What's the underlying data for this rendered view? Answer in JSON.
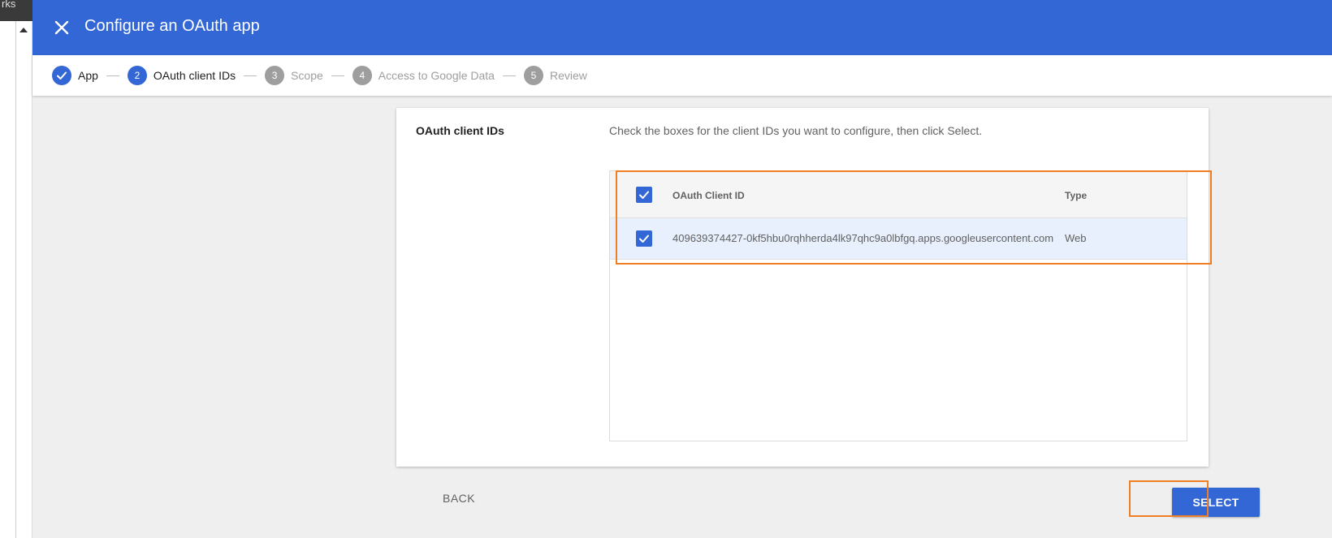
{
  "left_strip": {
    "tab_text": "rks"
  },
  "header": {
    "close_icon": "close-icon",
    "title": "Configure an OAuth app",
    "bg_color": "#3367d6"
  },
  "stepper": {
    "steps": [
      {
        "number": "",
        "label": "App",
        "state": "done",
        "icon": "check-icon"
      },
      {
        "number": "2",
        "label": "OAuth client IDs",
        "state": "active"
      },
      {
        "number": "3",
        "label": "Scope",
        "state": "pending"
      },
      {
        "number": "4",
        "label": "Access to Google Data",
        "state": "pending"
      },
      {
        "number": "5",
        "label": "Review",
        "state": "pending"
      }
    ]
  },
  "card": {
    "section_label": "OAuth client IDs",
    "instructions": "Check the boxes for the client IDs you want to configure, then click Select."
  },
  "table": {
    "columns": {
      "id": "OAuth Client ID",
      "type": "Type"
    },
    "header_checked": true,
    "rows": [
      {
        "checked": true,
        "id": "409639374427-0kf5hbu0rqhherda4lk97qhc9a0lbfgq.apps.googleusercontent.com",
        "type": "Web"
      }
    ]
  },
  "actions": {
    "back_label": "BACK",
    "select_label": "SELECT"
  },
  "colors": {
    "accent": "#3367d6",
    "highlight": "#f07f24",
    "selected_row": "#e8f0fe"
  }
}
